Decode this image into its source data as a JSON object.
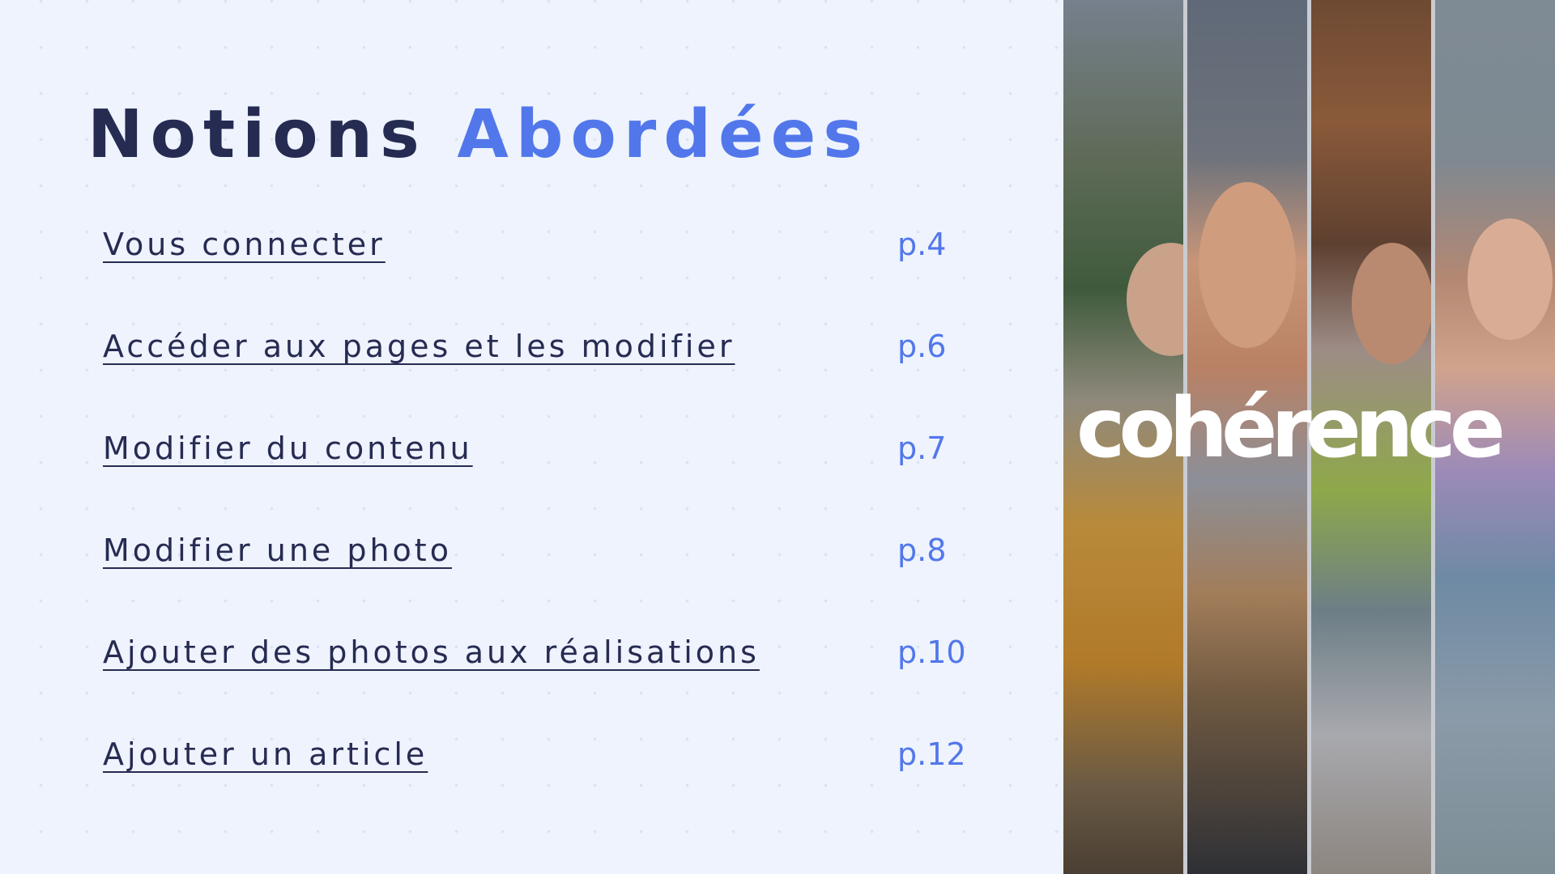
{
  "title": {
    "part1": "Notions",
    "part2": "Abordées"
  },
  "toc": [
    {
      "label": "Vous connecter",
      "page": "p.4"
    },
    {
      "label": "Accéder aux pages et les modifier",
      "page": "p.6"
    },
    {
      "label": "Modifier du contenu",
      "page": "p.7"
    },
    {
      "label": "Modifier une photo",
      "page": "p.8"
    },
    {
      "label": "Ajouter des photos aux réalisations",
      "page": "p.10"
    },
    {
      "label": "Ajouter un article",
      "page": "p.12"
    }
  ],
  "logo": {
    "text": "cohérence"
  },
  "colors": {
    "background": "#eef3fd",
    "title_dark": "#262b52",
    "accent": "#5277eb"
  }
}
